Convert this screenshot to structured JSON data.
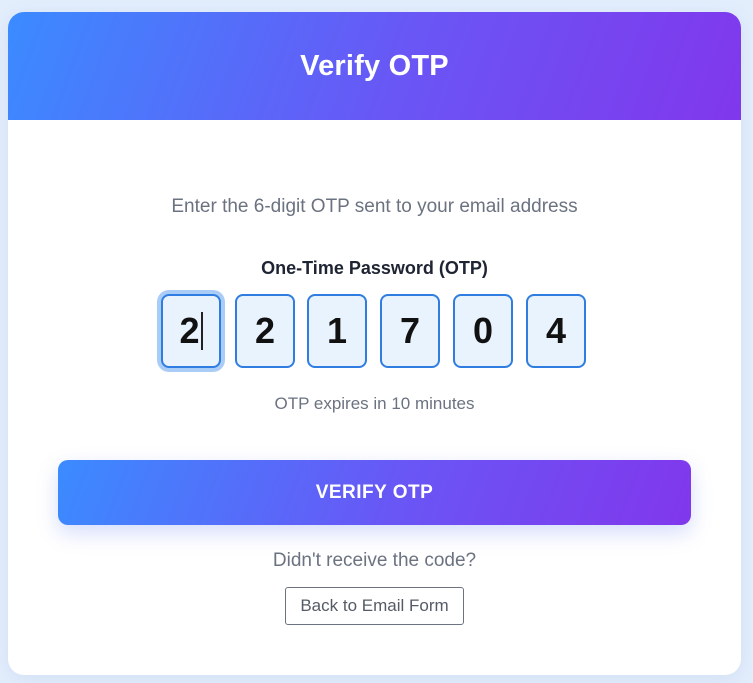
{
  "header": {
    "title": "Verify OTP"
  },
  "form": {
    "instruction": "Enter the 6-digit OTP sent to your email address",
    "otp_label": "One-Time Password (OTP)",
    "digits": [
      "2",
      "2",
      "1",
      "7",
      "0",
      "4"
    ],
    "expiry_text": "OTP expires in 10 minutes",
    "verify_label": "VERIFY OTP",
    "resend_prompt": "Didn't receive the code?",
    "back_label": "Back to Email Form"
  },
  "colors": {
    "gradient_start": "#3b8bff",
    "gradient_end": "#8137ec",
    "otp_border": "#2f7de1",
    "otp_fill": "#e8f3fe",
    "page_background": "#e3eefc"
  }
}
